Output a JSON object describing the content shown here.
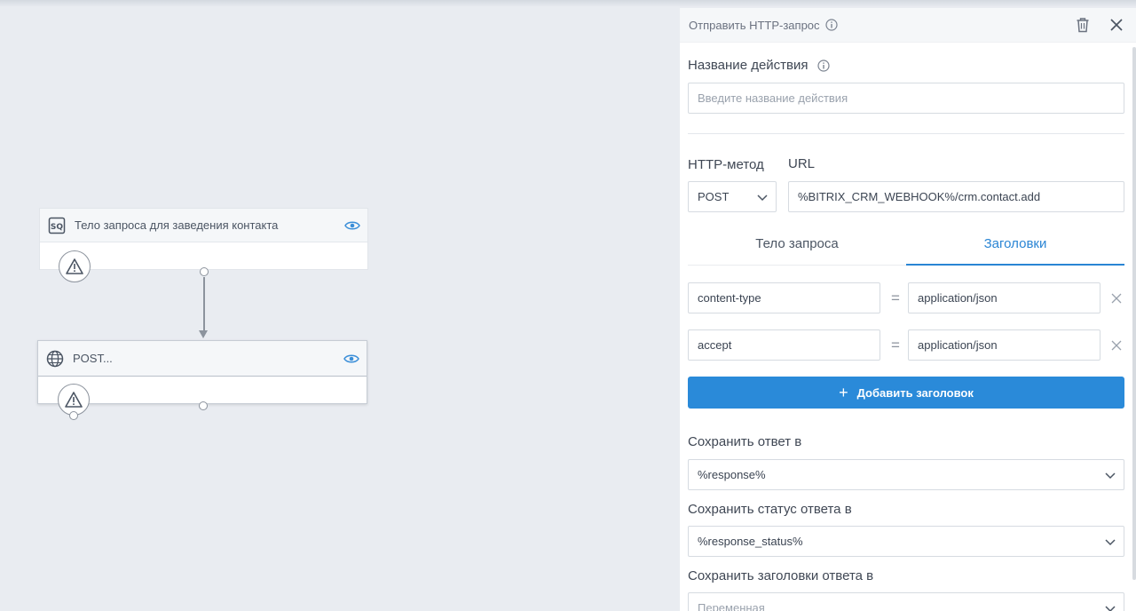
{
  "canvas": {
    "node1": {
      "badge": "SQ",
      "title": "Тело запроса для заведения контакта"
    },
    "node2": {
      "title": "POST..."
    }
  },
  "panel": {
    "title": "Отправить HTTP-запрос",
    "action_name_label": "Название действия",
    "action_name_placeholder": "Введите название действия",
    "method_label": "HTTP-метод",
    "method_value": "POST",
    "url_label": "URL",
    "url_value": "%BITRIX_CRM_WEBHOOK%/crm.contact.add",
    "tabs": [
      {
        "label": "Тело запроса",
        "active": false
      },
      {
        "label": "Заголовки",
        "active": true
      }
    ],
    "headers": [
      {
        "key": "content-type",
        "value": "application/json"
      },
      {
        "key": "accept",
        "value": "application/json"
      }
    ],
    "equals_sign": "=",
    "add_header_label": "Добавить заголовок",
    "add_header_plus": "+",
    "save_response_label": "Сохранить ответ в",
    "save_response_value": "%response%",
    "save_status_label": "Сохранить статус ответа в",
    "save_status_value": "%response_status%",
    "save_headers_label": "Сохранить заголовки ответа в",
    "save_headers_placeholder": "Переменная"
  },
  "colors": {
    "accent": "#2a85d4",
    "button": "#2a8ad9",
    "canvas_bg": "#e9ecf1",
    "icon_gray": "#8c939d"
  },
  "icons": [
    "sq-badge-icon",
    "eye-icon",
    "warning-icon",
    "globe-icon",
    "info-icon",
    "trash-icon",
    "close-icon",
    "chevron-down-icon",
    "remove-icon"
  ]
}
